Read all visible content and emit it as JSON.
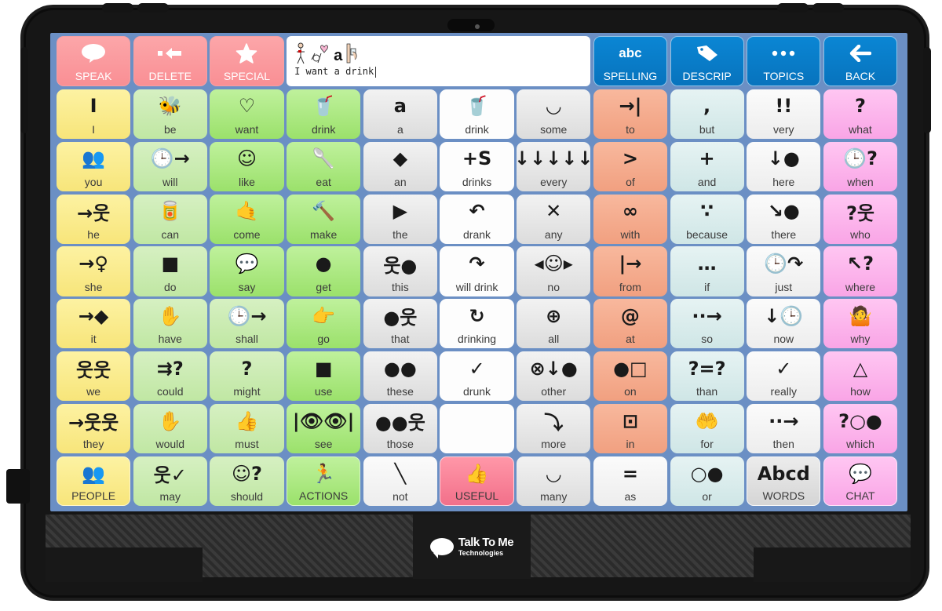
{
  "device": {
    "brand": "Talk To Me",
    "brand_sub": "Technologies"
  },
  "toolbar": {
    "left_buttons": [
      {
        "id": "speak",
        "label": "SPEAK",
        "icon": "speech-bubble-icon"
      },
      {
        "id": "delete",
        "label": "DELETE",
        "icon": "backspace-arrow-icon"
      },
      {
        "id": "special",
        "label": "SPECIAL",
        "icon": "star-icon"
      }
    ],
    "message": {
      "symbols": [
        "I",
        "want",
        "a",
        "drink"
      ],
      "text": "I want a drink"
    },
    "right_buttons": [
      {
        "id": "spelling",
        "label": "SPELLING",
        "icon_text": "abc"
      },
      {
        "id": "descrip",
        "label": "DESCRIP",
        "icon": "tag-icon"
      },
      {
        "id": "topics",
        "label": "TOPICS",
        "icon": "ellipsis-icon"
      },
      {
        "id": "back",
        "label": "BACK",
        "icon": "arrow-left-icon"
      }
    ]
  },
  "colors": {
    "speak_group": "#f98f94",
    "nav_group": "#0873bd",
    "pronoun": "#f7e57a",
    "verb_light": "#c0e7a3",
    "verb": "#9be16b",
    "determiner": "#dcdcdc",
    "preposition": "#f1a080",
    "conjunction": "#cfe6e6",
    "adverb": "#ededed",
    "question": "#f9a5e6",
    "useful": "#f2708a",
    "screen_bg": "#6b8fc4"
  },
  "grid": {
    "rows": [
      [
        {
          "label": "I",
          "color": "yellow",
          "symbol": "I"
        },
        {
          "label": "be",
          "color": "lightgreen",
          "symbol": "🐝"
        },
        {
          "label": "want",
          "color": "green",
          "symbol": "♡"
        },
        {
          "label": "drink",
          "color": "green",
          "symbol": "🥤"
        },
        {
          "label": "a",
          "color": "grey",
          "symbol": "a"
        },
        {
          "label": "drink",
          "color": "white",
          "symbol": "🥤"
        },
        {
          "label": "some",
          "color": "grey",
          "symbol": "◡"
        },
        {
          "label": "to",
          "color": "orange",
          "symbol": "→|"
        },
        {
          "label": "but",
          "color": "teal",
          "symbol": ","
        },
        {
          "label": "very",
          "color": "white2",
          "symbol": "!!"
        },
        {
          "label": "what",
          "color": "pink",
          "symbol": "?"
        }
      ],
      [
        {
          "label": "you",
          "color": "yellow",
          "symbol": "👥"
        },
        {
          "label": "will",
          "color": "lightgreen",
          "symbol": "🕒→"
        },
        {
          "label": "like",
          "color": "green",
          "symbol": "☺"
        },
        {
          "label": "eat",
          "color": "green",
          "symbol": "🥄"
        },
        {
          "label": "an",
          "color": "grey",
          "symbol": "◆"
        },
        {
          "label": "drinks",
          "color": "white",
          "symbol": "+S"
        },
        {
          "label": "every",
          "color": "grey",
          "symbol": "↓↓↓↓↓"
        },
        {
          "label": "of",
          "color": "orange",
          "symbol": ">"
        },
        {
          "label": "and",
          "color": "teal",
          "symbol": "+"
        },
        {
          "label": "here",
          "color": "white2",
          "symbol": "↓●"
        },
        {
          "label": "when",
          "color": "pink",
          "symbol": "🕒?"
        }
      ],
      [
        {
          "label": "he",
          "color": "yellow",
          "symbol": "→웃"
        },
        {
          "label": "can",
          "color": "lightgreen",
          "symbol": "🥫"
        },
        {
          "label": "come",
          "color": "green",
          "symbol": "🤙"
        },
        {
          "label": "make",
          "color": "green",
          "symbol": "🔨"
        },
        {
          "label": "the",
          "color": "grey",
          "symbol": "▶"
        },
        {
          "label": "drank",
          "color": "white",
          "symbol": "↶"
        },
        {
          "label": "any",
          "color": "grey",
          "symbol": "✕"
        },
        {
          "label": "with",
          "color": "orange",
          "symbol": "∞"
        },
        {
          "label": "because",
          "color": "teal",
          "symbol": "∵"
        },
        {
          "label": "there",
          "color": "white2",
          "symbol": "↘●"
        },
        {
          "label": "who",
          "color": "pink",
          "symbol": "?웃"
        }
      ],
      [
        {
          "label": "she",
          "color": "yellow",
          "symbol": "→♀"
        },
        {
          "label": "do",
          "color": "lightgreen",
          "symbol": "■"
        },
        {
          "label": "say",
          "color": "green",
          "symbol": "💬"
        },
        {
          "label": "get",
          "color": "green",
          "symbol": "●"
        },
        {
          "label": "this",
          "color": "grey",
          "symbol": "웃●"
        },
        {
          "label": "will drink",
          "color": "white",
          "symbol": "↷"
        },
        {
          "label": "no",
          "color": "grey",
          "symbol": "◂☺▸"
        },
        {
          "label": "from",
          "color": "orange",
          "symbol": "|→"
        },
        {
          "label": "if",
          "color": "teal",
          "symbol": "…"
        },
        {
          "label": "just",
          "color": "white2",
          "symbol": "🕒↷"
        },
        {
          "label": "where",
          "color": "pink",
          "symbol": "↖?"
        }
      ],
      [
        {
          "label": "it",
          "color": "yellow",
          "symbol": "→◆"
        },
        {
          "label": "have",
          "color": "lightgreen",
          "symbol": "✋"
        },
        {
          "label": "shall",
          "color": "lightgreen",
          "symbol": "🕒→"
        },
        {
          "label": "go",
          "color": "green",
          "symbol": "👉"
        },
        {
          "label": "that",
          "color": "grey",
          "symbol": "●웃"
        },
        {
          "label": "drinking",
          "color": "white",
          "symbol": "↻"
        },
        {
          "label": "all",
          "color": "grey",
          "symbol": "⊕"
        },
        {
          "label": "at",
          "color": "orange",
          "symbol": "@"
        },
        {
          "label": "so",
          "color": "teal",
          "symbol": "··→"
        },
        {
          "label": "now",
          "color": "white2",
          "symbol": "↓🕒"
        },
        {
          "label": "why",
          "color": "pink",
          "symbol": "🤷"
        }
      ],
      [
        {
          "label": "we",
          "color": "yellow",
          "symbol": "웃웃"
        },
        {
          "label": "could",
          "color": "lightgreen",
          "symbol": "⇉?"
        },
        {
          "label": "might",
          "color": "lightgreen",
          "symbol": "?"
        },
        {
          "label": "use",
          "color": "green",
          "symbol": "■"
        },
        {
          "label": "these",
          "color": "grey",
          "symbol": "●●"
        },
        {
          "label": "drunk",
          "color": "white",
          "symbol": "✓"
        },
        {
          "label": "other",
          "color": "grey",
          "symbol": "⊗↓●"
        },
        {
          "label": "on",
          "color": "orange",
          "symbol": "●□"
        },
        {
          "label": "than",
          "color": "teal",
          "symbol": "?=?"
        },
        {
          "label": "really",
          "color": "white2",
          "symbol": "✓"
        },
        {
          "label": "how",
          "color": "pink",
          "symbol": "△"
        }
      ],
      [
        {
          "label": "they",
          "color": "yellow",
          "symbol": "→웃웃"
        },
        {
          "label": "would",
          "color": "lightgreen",
          "symbol": "✋"
        },
        {
          "label": "must",
          "color": "lightgreen",
          "symbol": "👍"
        },
        {
          "label": "see",
          "color": "green",
          "symbol": "|👁👁|"
        },
        {
          "label": "those",
          "color": "grey",
          "symbol": "●●웃"
        },
        {
          "label": "",
          "color": "white",
          "symbol": ""
        },
        {
          "label": "more",
          "color": "grey",
          "symbol": "⤵"
        },
        {
          "label": "in",
          "color": "orange",
          "symbol": "⊡"
        },
        {
          "label": "for",
          "color": "teal",
          "symbol": "🤲"
        },
        {
          "label": "then",
          "color": "white2",
          "symbol": "··→"
        },
        {
          "label": "which",
          "color": "pink",
          "symbol": "?○●"
        }
      ],
      [
        {
          "label": "PEOPLE",
          "color": "people",
          "symbol": "👥"
        },
        {
          "label": "may",
          "color": "lightgreen",
          "symbol": "웃✓"
        },
        {
          "label": "should",
          "color": "lightgreen",
          "symbol": "☺?"
        },
        {
          "label": "ACTIONS",
          "color": "actions",
          "symbol": "🏃"
        },
        {
          "label": "not",
          "color": "white2",
          "symbol": "╲"
        },
        {
          "label": "USEFUL",
          "color": "rose",
          "symbol": "👍"
        },
        {
          "label": "many",
          "color": "grey",
          "symbol": "◡"
        },
        {
          "label": "as",
          "color": "white2",
          "symbol": "="
        },
        {
          "label": "or",
          "color": "teal",
          "symbol": "○●"
        },
        {
          "label": "WORDS",
          "color": "words",
          "symbol": "Abcd"
        },
        {
          "label": "CHAT",
          "color": "chat",
          "symbol": "💬"
        }
      ]
    ]
  }
}
